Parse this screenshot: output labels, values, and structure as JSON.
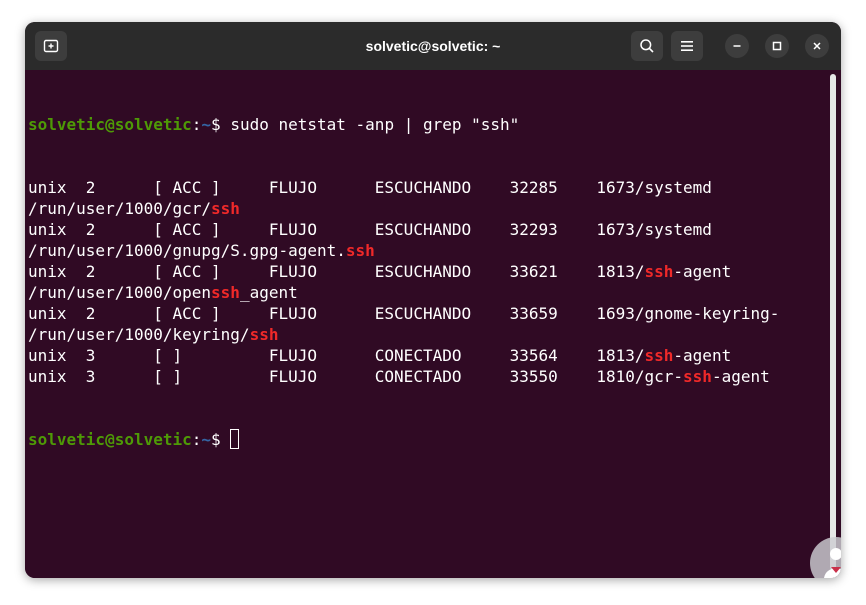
{
  "window": {
    "title": "solvetic@solvetic: ~",
    "buttons": [
      "new-tab",
      "search",
      "menu",
      "minimize",
      "maximize",
      "close"
    ]
  },
  "colors": {
    "terminal_bg": "#300a24",
    "titlebar_bg": "#2b2b2b",
    "prompt_user": "#4e9a06",
    "prompt_path": "#3465a4",
    "match_highlight": "#ef2929"
  },
  "prompt": {
    "user_host": "solvetic@solvetic",
    "colon": ":",
    "path": "~",
    "symbol": "$ "
  },
  "command": "sudo netstat -anp | grep \"ssh\"",
  "output_lines": [
    [
      "unix  2      [ ACC ]     FLUJO      ESCUCHANDO    32285    1673/systemd"
    ],
    [
      "/run/user/1000/gcr/",
      {
        "m": "ssh"
      }
    ],
    [
      "unix  2      [ ACC ]     FLUJO      ESCUCHANDO    32293    1673/systemd"
    ],
    [
      "/run/user/1000/gnupg/S.gpg-agent.",
      {
        "m": "ssh"
      }
    ],
    [
      "unix  2      [ ACC ]     FLUJO      ESCUCHANDO    33621    1813/",
      {
        "m": "ssh"
      },
      "-agent"
    ],
    [
      "/run/user/1000/open",
      {
        "m": "ssh"
      },
      "_agent"
    ],
    [
      "unix  2      [ ACC ]     FLUJO      ESCUCHANDO    33659    1693/gnome-keyring-"
    ],
    [
      "/run/user/1000/keyring/",
      {
        "m": "ssh"
      }
    ],
    [
      "unix  3      [ ]         FLUJO      CONECTADO     33564    1813/",
      {
        "m": "ssh"
      },
      "-agent"
    ],
    [
      "unix  3      [ ]         FLUJO      CONECTADO     33550    1810/gcr-",
      {
        "m": "ssh"
      },
      "-agent"
    ]
  ],
  "watermark": "solvetic-logo-icon"
}
